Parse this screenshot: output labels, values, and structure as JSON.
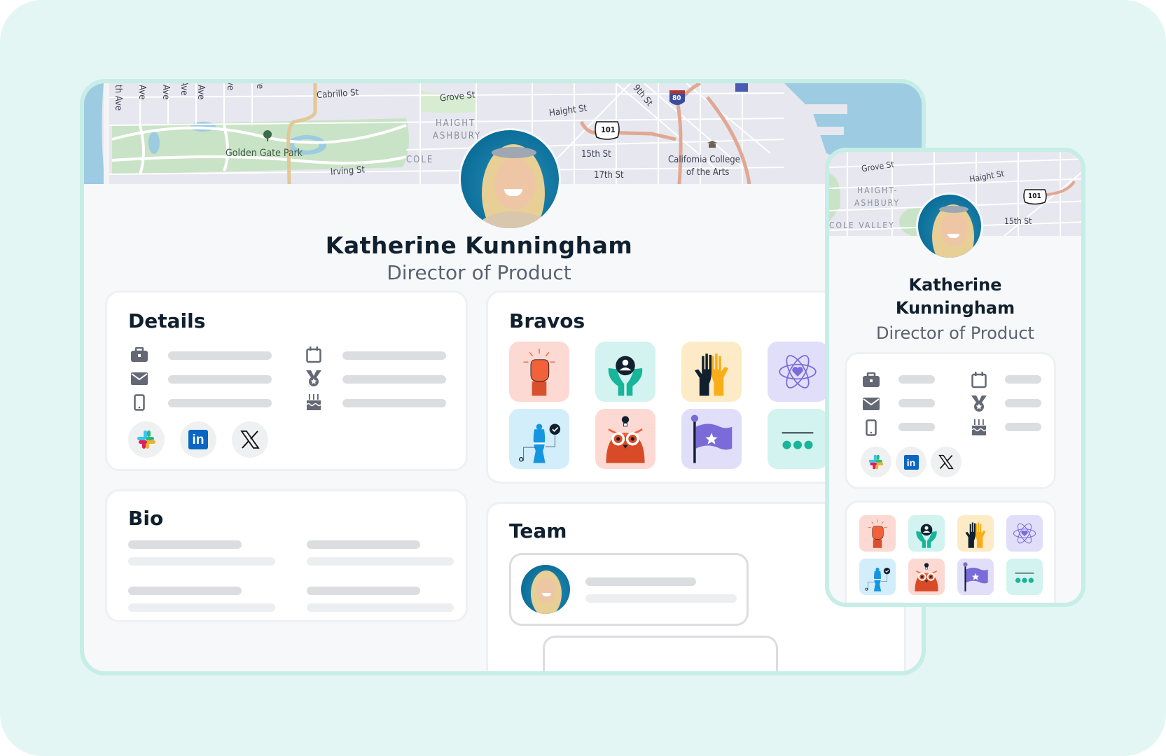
{
  "profile": {
    "name": "Katherine Kunningham",
    "name_first": "Katherine",
    "name_last": "Kunningham",
    "title": "Director of Product"
  },
  "map": {
    "streets": [
      "Cabrillo St",
      "Grove St",
      "Haight St",
      "9th St",
      "15th St",
      "17th St",
      "Irving St",
      "th Ave",
      "Ave",
      "Ave",
      "Ave",
      "Ave",
      "ve",
      "ve"
    ],
    "park": "Golden Gate Park",
    "districts": [
      "HAIGHT",
      "ASHBURY",
      "COLE"
    ],
    "poi": [
      "California College",
      "of the Arts"
    ],
    "highways": [
      "101",
      "80"
    ],
    "mini": {
      "streets": [
        "Grove St",
        "Haight St",
        "15th St"
      ],
      "districts": [
        "HAIGHT-",
        "ASHBURY",
        "COLE VALLEY"
      ],
      "highway": "101"
    }
  },
  "sections": {
    "details": "Details",
    "bravos": "Bravos",
    "bio": "Bio",
    "team": "Team"
  },
  "details": {
    "left_icons": [
      "briefcase-icon",
      "envelope-icon",
      "mobile-phone-icon"
    ],
    "right_icons": [
      "calendar-icon",
      "medal-icon",
      "birthday-cake-icon"
    ]
  },
  "socials": [
    {
      "name": "Slack",
      "icon": "slack-icon"
    },
    {
      "name": "LinkedIn",
      "icon": "linkedin-icon",
      "glyph": "in"
    },
    {
      "name": "X",
      "icon": "x-icon",
      "glyph": "𝕏"
    }
  ],
  "bravos": [
    {
      "name": "raised-fist",
      "bg": "#fcd9d3"
    },
    {
      "name": "hands-holding-person",
      "bg": "#d2f3ef"
    },
    {
      "name": "high-five",
      "bg": "#fdebc8"
    },
    {
      "name": "atom-heart",
      "bg": "#e1defa"
    },
    {
      "name": "chess-queen",
      "bg": "#d2eefb"
    },
    {
      "name": "owl-idea",
      "bg": "#fcd9d3"
    },
    {
      "name": "star-flag",
      "bg": "#e1defa"
    },
    {
      "name": "team-dots",
      "bg": "#d2f3ef"
    }
  ],
  "colors": {
    "background": "#e3f6f3",
    "window_border": "#c6ede6",
    "heading": "#10202e",
    "subtitle": "#5b6270",
    "icon_gray": "#636874",
    "skeleton": "#dcdde0",
    "linkedin": "#0a66c2"
  }
}
